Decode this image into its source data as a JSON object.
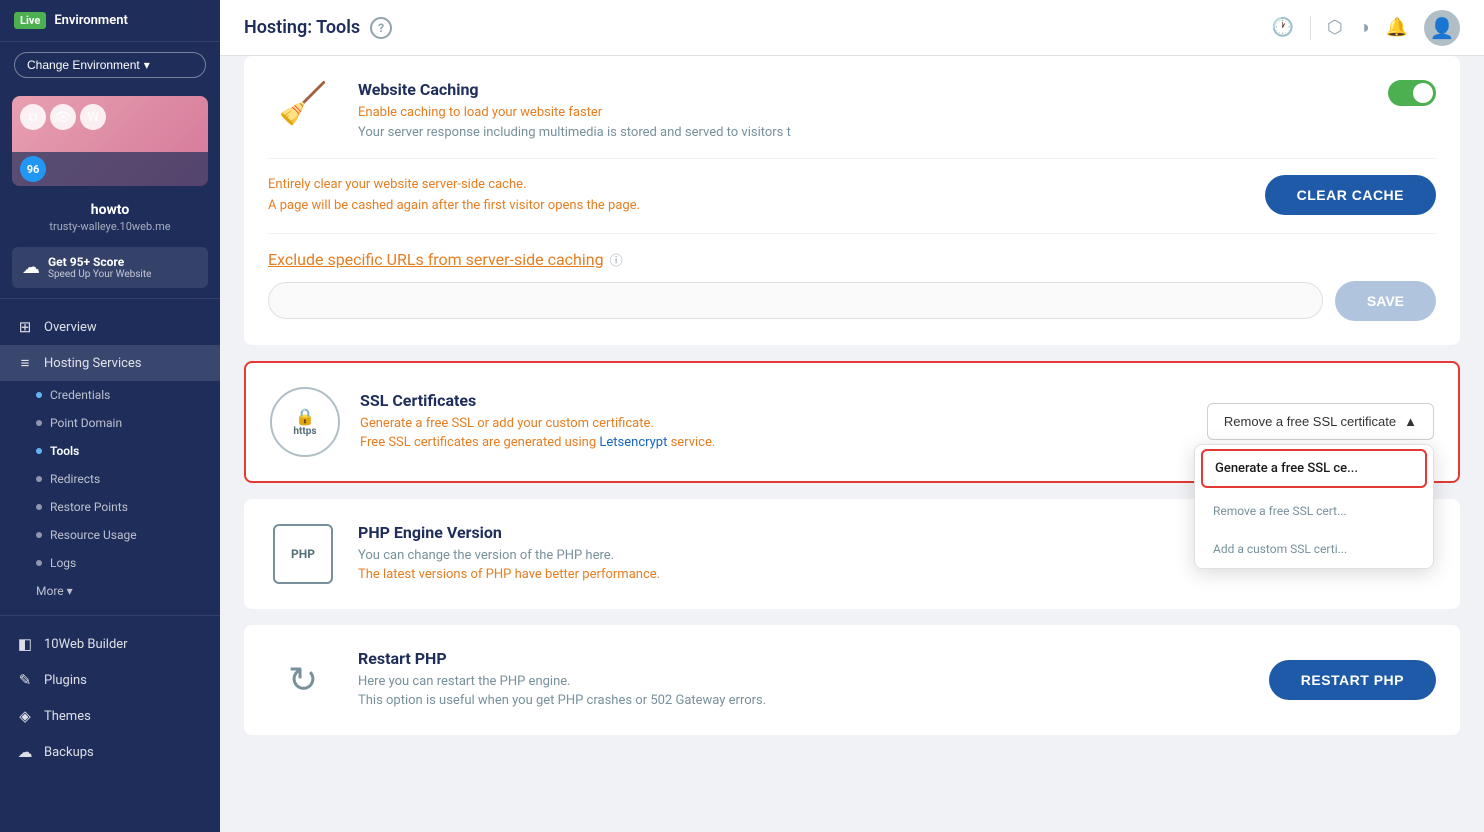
{
  "sidebar": {
    "live_badge": "Live",
    "env_label": "Environment",
    "change_env_btn": "Change Environment",
    "score": "96",
    "site_name": "howto",
    "site_url": "trusty-walleye.10web.me",
    "speed_title": "Get 95+ Score",
    "speed_subtitle": "Speed Up Your Website",
    "nav_items": [
      {
        "id": "overview",
        "label": "Overview",
        "icon": "⊞"
      },
      {
        "id": "hosting-services",
        "label": "Hosting Services",
        "icon": "≡",
        "active": true
      }
    ],
    "sub_items": [
      {
        "id": "credentials",
        "label": "Credentials",
        "icon": "ℹ"
      },
      {
        "id": "point-domain",
        "label": "Point Domain",
        "icon": "🌐"
      },
      {
        "id": "tools",
        "label": "Tools",
        "icon": "⚙",
        "active": true
      },
      {
        "id": "redirects",
        "label": "Redirects",
        "icon": "↪"
      },
      {
        "id": "restore-points",
        "label": "Restore Points",
        "icon": "↺"
      },
      {
        "id": "resource-usage",
        "label": "Resource Usage",
        "icon": "◎"
      },
      {
        "id": "logs",
        "label": "Logs",
        "icon": "📄"
      }
    ],
    "more_label": "More ▾",
    "bottom_items": [
      {
        "id": "10web-builder",
        "label": "10Web Builder",
        "icon": "◧"
      },
      {
        "id": "plugins",
        "label": "Plugins",
        "icon": "✎"
      },
      {
        "id": "themes",
        "label": "Themes",
        "icon": "◈"
      },
      {
        "id": "backups",
        "label": "Backups",
        "icon": "☁"
      }
    ]
  },
  "topbar": {
    "title": "Hosting: Tools",
    "help_label": "?",
    "icons": [
      "🕐",
      "🥧",
      "🌙",
      "🔔"
    ]
  },
  "caching_card": {
    "title": "Website Caching",
    "desc_line1": "Enable caching to load your website faster",
    "desc_line2": "Your server response including multimedia is stored and served to visitors t",
    "toggle_on": true,
    "clear_cache_section": {
      "line1": "Entirely clear your website server-side cache.",
      "line2": "A page will be cashed again after the first visitor opens the page.",
      "button_label": "CLEAR CACHE"
    },
    "exclude_label": "Exclude specific URLs from server-side caching",
    "url_placeholder": "",
    "save_button": "SAVE"
  },
  "ssl_card": {
    "title": "SSL Certificates",
    "desc_line1": "Generate a free SSL or add your custom certificate.",
    "desc_line2_prefix": "Free SSL certificates are generated using ",
    "letsencrypt_label": "Letsencrypt",
    "desc_line2_suffix": " service.",
    "dropdown_selected": "Remove a free SSL certificate",
    "dropdown_options": [
      {
        "id": "generate",
        "label": "Generate a free SSL ce...",
        "highlighted": true
      },
      {
        "id": "remove",
        "label": "Remove a free SSL cert..."
      },
      {
        "id": "custom",
        "label": "Add a custom SSL certi..."
      }
    ]
  },
  "php_card": {
    "title": "PHP Engine Version",
    "desc_line1": "You can change the version of the PHP here.",
    "desc_line2": "The latest versions of PHP have better performance."
  },
  "restart_php_card": {
    "title": "Restart PHP",
    "desc_line1": "Here you can restart the PHP engine.",
    "desc_line2": "This option is useful when you get PHP crashes or 502 Gateway errors.",
    "button_label": "RESTART PHP"
  }
}
